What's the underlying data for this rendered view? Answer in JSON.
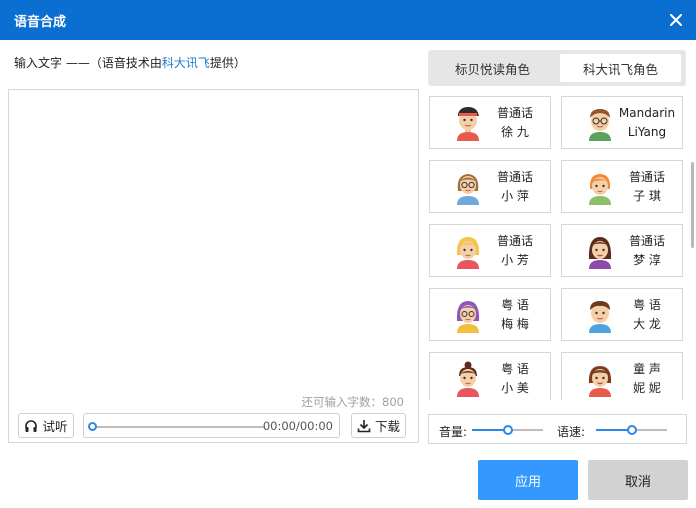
{
  "window": {
    "title": "语音合成"
  },
  "input": {
    "label_prefix": "输入文字 ——（语音技术由",
    "label_link": "科大讯飞",
    "label_suffix": "提供）",
    "text_value": "",
    "remaining_label": "还可输入字数：",
    "remaining_count": "800"
  },
  "player": {
    "listen_label": "试听",
    "time": "00:00/00:00",
    "download_label": "下载"
  },
  "tabs": [
    {
      "label": "标贝悦读角色",
      "active": false
    },
    {
      "label": "科大讯飞角色",
      "active": true
    }
  ],
  "voices": [
    {
      "line1": "普通话",
      "line2": "徐 九"
    },
    {
      "line1": "Mandarin",
      "line2": "LiYang"
    },
    {
      "line1": "普通话",
      "line2": "小 萍"
    },
    {
      "line1": "普通话",
      "line2": "子 琪"
    },
    {
      "line1": "普通话",
      "line2": "小 芳"
    },
    {
      "line1": "普通话",
      "line2": "梦 淳"
    },
    {
      "line1": "粤 语",
      "line2": "梅 梅"
    },
    {
      "line1": "粤 语",
      "line2": "大 龙"
    },
    {
      "line1": "粤 语",
      "line2": "小 美"
    },
    {
      "line1": "童 声",
      "line2": "妮 妮"
    }
  ],
  "controls": {
    "volume_label": "音量:",
    "volume_level": 0.5,
    "speed_label": "语速:",
    "speed_level": 0.5
  },
  "buttons": {
    "apply": "应用",
    "cancel": "取消"
  },
  "colors": {
    "titlebar": "#0a6fd0",
    "accent": "#3399ff",
    "link": "#1a7fd6"
  }
}
